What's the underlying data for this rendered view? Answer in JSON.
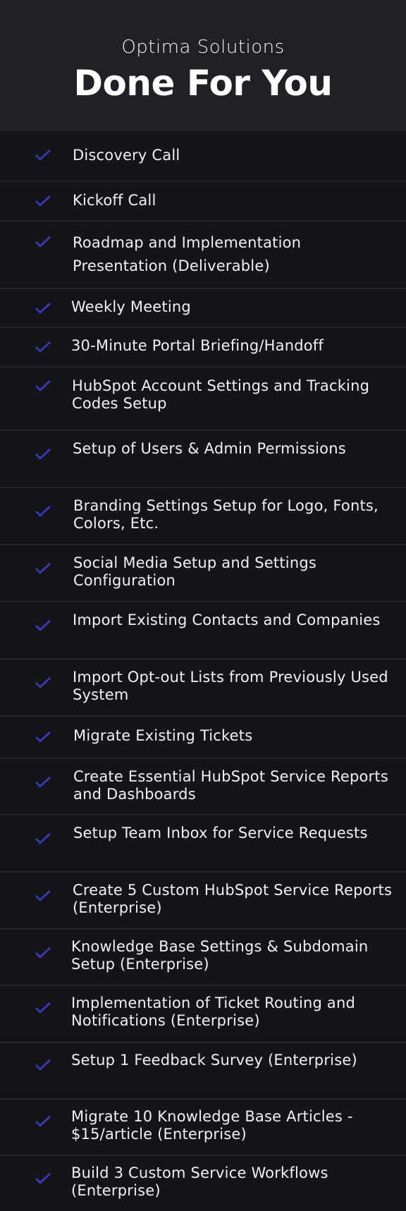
{
  "header": {
    "subtitle": "Optima Solutions",
    "title": "Done For You"
  },
  "colors": {
    "header_bg": "#202126",
    "list_bg": "#141419",
    "divider": "#25262b",
    "check": "#3a3dc2",
    "text": "#f2f2f4"
  },
  "checklist": {
    "items": [
      {
        "icon": "check-icon",
        "label": "Discovery Call"
      },
      {
        "icon": "check-icon",
        "label": "Kickoff Call"
      },
      {
        "icon": "check-icon",
        "label": "Roadmap and Implementation Presentation (Deliverable)"
      },
      {
        "icon": "check-icon",
        "label": "Weekly Meeting"
      },
      {
        "icon": "check-icon",
        "label": "30-Minute Portal Briefing/Handoff"
      },
      {
        "icon": "check-icon",
        "label": "HubSpot Account Settings and Tracking Codes Setup"
      },
      {
        "icon": "check-icon",
        "label": "Setup of Users & Admin Permissions"
      },
      {
        "icon": "check-icon",
        "label": "Branding Settings Setup for Logo, Fonts, Colors, Etc."
      },
      {
        "icon": "check-icon",
        "label": "Social Media Setup and Settings Configuration"
      },
      {
        "icon": "check-icon",
        "label": "Import Existing Contacts and Companies"
      },
      {
        "icon": "check-icon",
        "label": "Import Opt-out Lists from Previously Used System"
      },
      {
        "icon": "check-icon",
        "label": "Migrate Existing Tickets"
      },
      {
        "icon": "check-icon",
        "label": "Create Essential HubSpot Service Reports and Dashboards"
      },
      {
        "icon": "check-icon",
        "label": "Setup Team Inbox for Service Requests"
      },
      {
        "icon": "check-icon",
        "label": "Create 5 Custom HubSpot Service Reports (Enterprise)"
      },
      {
        "icon": "check-icon",
        "label": "Knowledge Base Settings & Subdomain Setup (Enterprise)"
      },
      {
        "icon": "check-icon",
        "label": "Implementation of Ticket Routing and Notifications (Enterprise)"
      },
      {
        "icon": "check-icon",
        "label": "Setup 1 Feedback Survey (Enterprise)"
      },
      {
        "icon": "check-icon",
        "label": "Migrate 10 Knowledge Base Articles - $15/article (Enterprise)"
      },
      {
        "icon": "check-icon",
        "label": "Build 3 Custom Service Workflows (Enterprise)"
      }
    ]
  }
}
